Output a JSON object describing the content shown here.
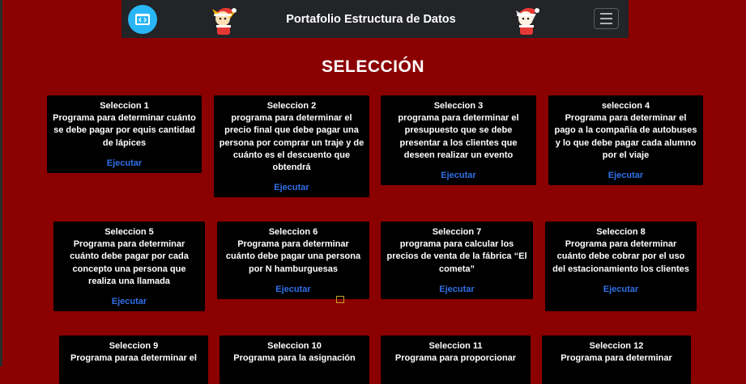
{
  "navbar": {
    "title": "Portafolio Estructura de Datos",
    "logo_icon": "code-window-icon",
    "mascot_icon": "chibi-santa-mascot-icon",
    "menu_icon": "hamburger-menu-icon"
  },
  "page": {
    "title": "SELECCIÓN"
  },
  "colors": {
    "background": "#8b0000",
    "navbar": "#222428",
    "card": "#000000",
    "link": "#2f6fe6"
  },
  "cards": [
    {
      "title": "Seleccion 1",
      "desc": "Programa para determinar cuánto se debe pagar por equis cantidad de lápices",
      "action": "Ejecutar"
    },
    {
      "title": "Seleccion 2",
      "desc": "programa para determinar el precio final que debe pagar una persona por comprar un traje y de cuánto es el descuento que obtendrá",
      "action": "Ejecutar"
    },
    {
      "title": "Seleccion 3",
      "desc": "programa para determinar el presupuesto que se debe presentar a los clientes que deseen realizar un evento",
      "action": "Ejecutar"
    },
    {
      "title": "seleccion 4",
      "desc": "Programa para determinar el pago a la compañía de autobuses y lo que debe pagar cada alumno por el viaje",
      "action": "Ejecutar"
    },
    {
      "title": "Seleccion 5",
      "desc": "Programa para determinar cuánto debe pagar por cada concepto una persona que realiza una llamada",
      "action": "Ejecutar"
    },
    {
      "title": "Seleccion 6",
      "desc": "Programa para determinar cuánto debe pagar una persona por N hamburguesas",
      "action": "Ejecutar"
    },
    {
      "title": "Seleccion 7",
      "desc": "programa para calcular los precios de venta de la fábrica “El cometa”",
      "action": "Ejecutar"
    },
    {
      "title": "Seleccion 8",
      "desc": "Programa para determinar cuánto debe cobrar por el uso del estacionamiento los clientes",
      "action": "Ejecutar"
    },
    {
      "title": "Seleccion 9",
      "desc": "Programa paraa determinar el",
      "action": ""
    },
    {
      "title": "Seleccion 10",
      "desc": "Programa para la asignación",
      "action": ""
    },
    {
      "title": "Seleccion 11",
      "desc": "Programa para proporcionar",
      "action": ""
    },
    {
      "title": "Seleccion 12",
      "desc": "Programa para determinar",
      "action": ""
    }
  ]
}
